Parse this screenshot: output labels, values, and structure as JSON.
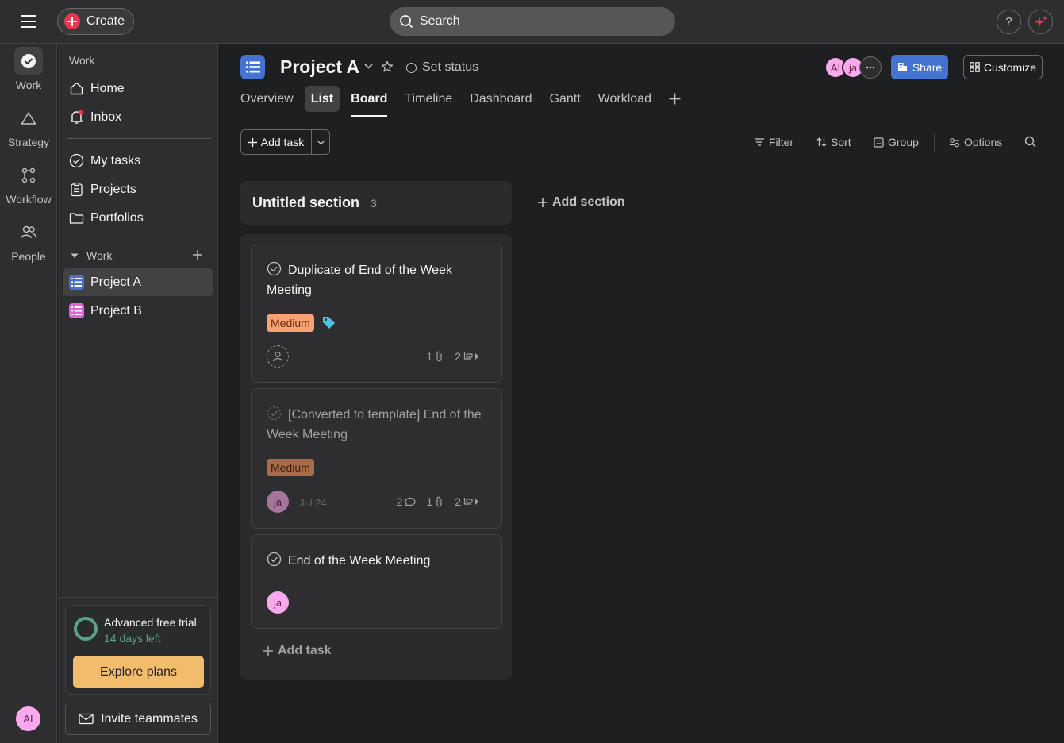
{
  "topbar": {
    "create_label": "Create",
    "search_placeholder": "Search",
    "help_label": "?"
  },
  "rail": {
    "items": [
      {
        "label": "Work",
        "icon": "check-circle-icon",
        "active": true
      },
      {
        "label": "Strategy",
        "icon": "triangle-icon"
      },
      {
        "label": "Workflow",
        "icon": "workflow-icon"
      },
      {
        "label": "People",
        "icon": "people-icon"
      }
    ],
    "avatar_initials": "AI"
  },
  "sidebar": {
    "heading_work": "Work",
    "nav": [
      {
        "label": "Home",
        "icon": "home-icon"
      },
      {
        "label": "Inbox",
        "icon": "bell-icon"
      }
    ],
    "nav2": [
      {
        "label": "My tasks",
        "icon": "check-circle-icon"
      },
      {
        "label": "Projects",
        "icon": "clipboard-icon"
      },
      {
        "label": "Portfolios",
        "icon": "folder-icon"
      }
    ],
    "team_heading": "Work",
    "projects": [
      {
        "label": "Project A",
        "color": "#4573d2",
        "active": true
      },
      {
        "label": "Project B",
        "color": "#e362e3"
      }
    ],
    "trial_title": "Advanced free trial",
    "trial_days": "14 days left",
    "explore_label": "Explore plans",
    "invite_label": "Invite teammates"
  },
  "project": {
    "title": "Project A",
    "set_status": "Set status",
    "members": [
      "AI",
      "ja"
    ],
    "share_label": "Share",
    "customize_label": "Customize",
    "tabs": [
      "Overview",
      "List",
      "Board",
      "Timeline",
      "Dashboard",
      "Gantt",
      "Workload"
    ],
    "active_tab": "Board"
  },
  "toolbar": {
    "add_task_label": "Add task",
    "filter_label": "Filter",
    "sort_label": "Sort",
    "group_label": "Group",
    "options_label": "Options"
  },
  "board": {
    "section_title": "Untitled section",
    "section_count": "3",
    "add_section_label": "Add section",
    "add_task_label": "Add task",
    "cards": [
      {
        "title": "Duplicate of End of the Week Meeting",
        "tag": "Medium",
        "attachments": "1",
        "subtasks": "2"
      },
      {
        "title": "[Converted to template] End of the Week Meeting",
        "tag": "Medium",
        "assignee": "ja",
        "due": "Jul 24",
        "comments": "2",
        "attachments": "1",
        "subtasks": "2"
      },
      {
        "title": "End of the Week Meeting",
        "assignee": "ja"
      }
    ]
  },
  "colors": {
    "accent": "#4573d2",
    "create": "#e8384f",
    "medium_tag": "#f8a172",
    "trial": "#5da283",
    "explore": "#f1bd6c"
  }
}
